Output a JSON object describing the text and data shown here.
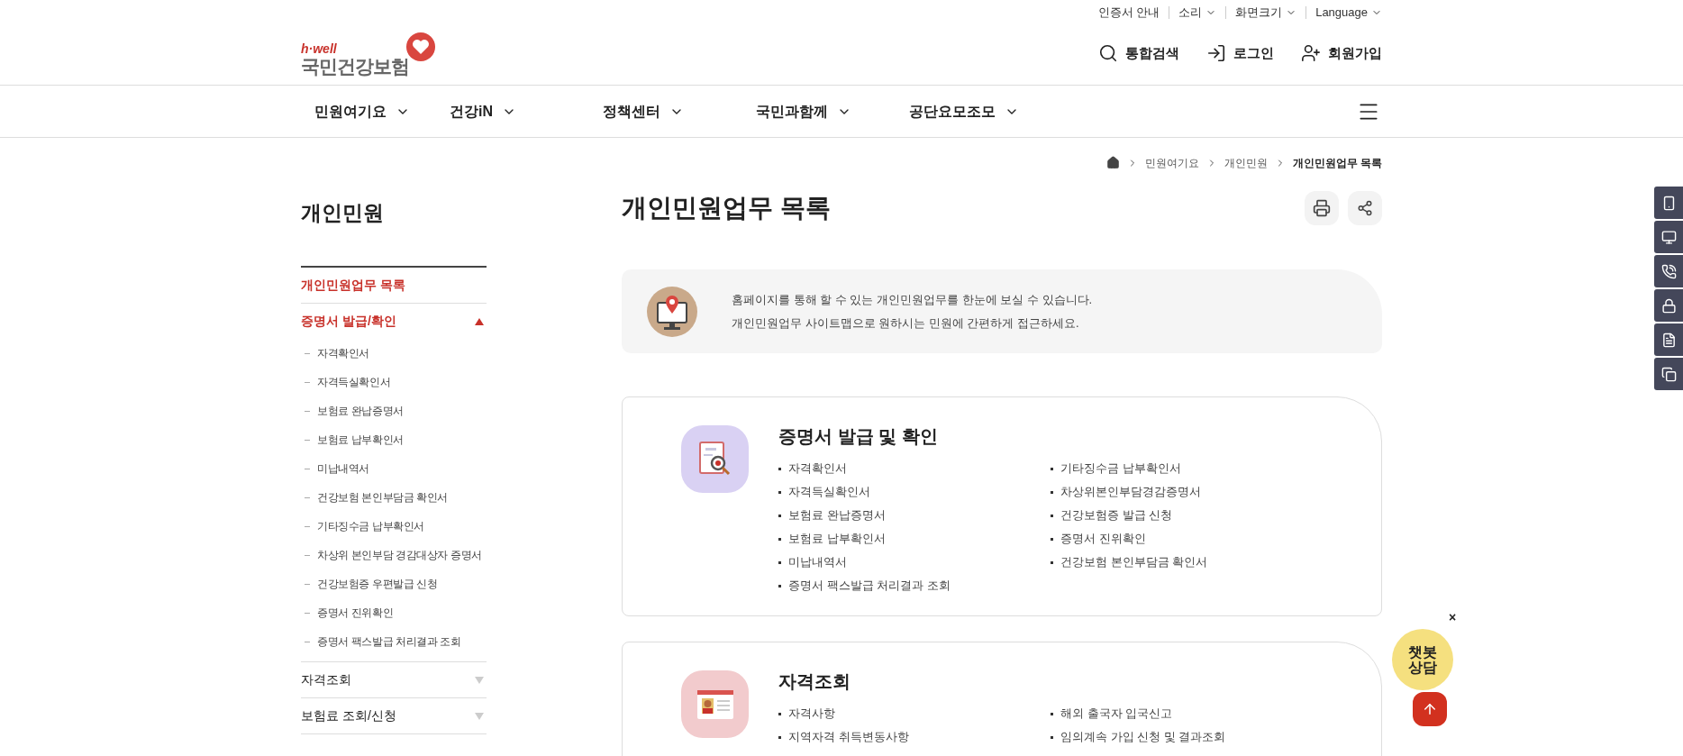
{
  "utility_links": [
    {
      "label": "인증서 안내",
      "dropdown": false
    },
    {
      "label": "소리",
      "dropdown": true
    },
    {
      "label": "화면크기",
      "dropdown": true
    },
    {
      "label": "Language",
      "dropdown": true
    }
  ],
  "logo": {
    "tagline": "h·well",
    "name": "국민건강보험"
  },
  "header_actions": [
    {
      "kind": "search",
      "label": "통합검색"
    },
    {
      "kind": "login",
      "label": "로그인"
    },
    {
      "kind": "signup",
      "label": "회원가입"
    }
  ],
  "nav": [
    "민원여기요",
    "건강iN",
    "정책센터",
    "국민과함께",
    "공단요모조모"
  ],
  "breadcrumb": [
    "민원여기요",
    "개인민원",
    "개인민원업무 목록"
  ],
  "sidebar": {
    "title": "개인민원",
    "items": [
      {
        "kind": "link",
        "label": "개인민원업무 목록",
        "selected": true
      },
      {
        "kind": "group",
        "label": "증명서 발급/확인",
        "selected": true,
        "expanded": true,
        "children": [
          "자격확인서",
          "자격득실확인서",
          "보험료 완납증명서",
          "보험료 납부확인서",
          "미납내역서",
          "건강보험 본인부담금 확인서",
          "기타징수금 납부확인서",
          "차상위 본인부담 경감대상자 증명서",
          "건강보험증 우편발급 신청",
          "증명서 진위확인",
          "증명서 팩스발급 처리결과 조회"
        ]
      },
      {
        "kind": "group",
        "label": "자격조회",
        "selected": false,
        "expanded": false
      },
      {
        "kind": "group",
        "label": "보험료 조회/신청",
        "selected": false,
        "expanded": false
      }
    ]
  },
  "page_title": "개인민원업무 목록",
  "intro": [
    "홈페이지를 통해 할 수 있는 개인민원업무를 한눈에 보실 수 있습니다.",
    "개인민원업무 사이트맵으로 원하시는 민원에 간편하게 접근하세요."
  ],
  "sections": [
    {
      "kind": "certificate",
      "title": "증명서 발급 및 확인",
      "left": [
        "자격확인서",
        "자격득실확인서",
        "보험료 완납증명서",
        "보험료 납부확인서",
        "미납내역서",
        "증명서 팩스발급 처리결과 조회"
      ],
      "right": [
        "기타징수금 납부확인서",
        "차상위본인부담경감증명서",
        "건강보험증 발급 신청",
        "증명서 진위확인",
        "건강보험 본인부담금 확인서"
      ]
    },
    {
      "kind": "qualification",
      "title": "자격조회",
      "left": [
        "자격사항",
        "지역자격 취득변동사항"
      ],
      "right": [
        "해외 출국자 입국신고",
        "임의계속 가입 신청 및 결과조회"
      ]
    }
  ],
  "chatbot": {
    "label": "챗봇상담",
    "close": "×"
  }
}
